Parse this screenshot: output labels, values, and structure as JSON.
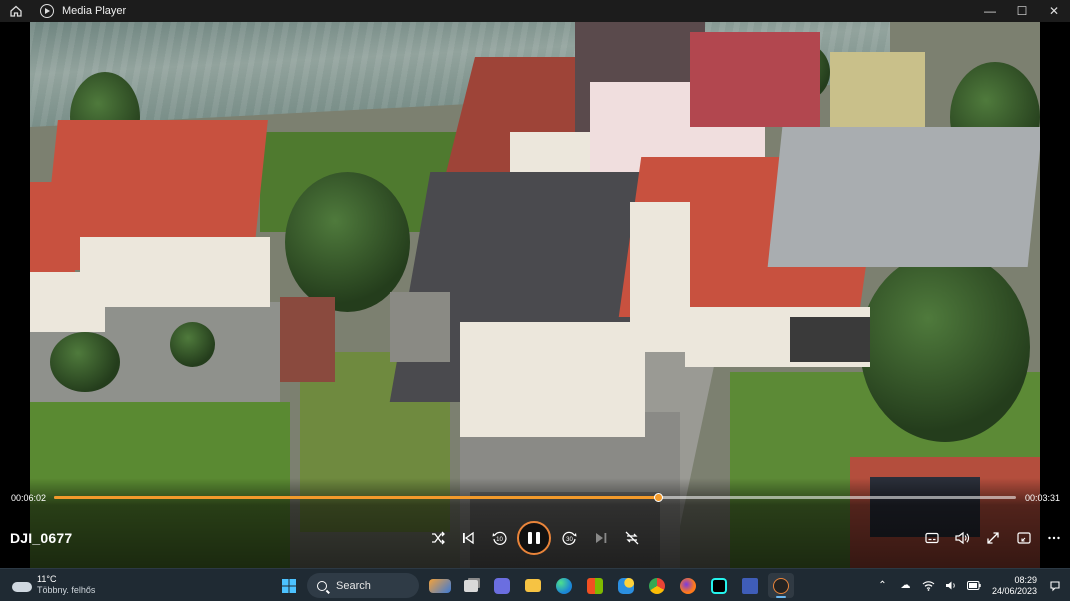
{
  "window": {
    "title": "Media Player",
    "home_icon": "home-icon",
    "controls": {
      "minimize": "—",
      "maximize": "☐",
      "close": "✕"
    }
  },
  "player": {
    "elapsed": "00:06:02",
    "remaining": "00:03:31",
    "progress": 0.628,
    "clip_name": "DJI_0677",
    "accent": "#f39a2b"
  },
  "controls": {
    "shuffle": "shuffle-icon",
    "previous": "previous-icon",
    "rewind_label": "10",
    "play_pause": "pause-icon",
    "forward_label": "30",
    "next": "next-icon",
    "repeat": "repeat-off-icon",
    "right": [
      "subtitles-icon",
      "volume-icon",
      "fullscreen-icon",
      "miniplayer-icon",
      "more-icon"
    ]
  },
  "taskbar": {
    "weather": {
      "temp": "11°C",
      "condition": "Többny. felhős"
    },
    "search_placeholder": "Search",
    "clock": {
      "time": "08:29",
      "date": "24/06/2023"
    }
  }
}
